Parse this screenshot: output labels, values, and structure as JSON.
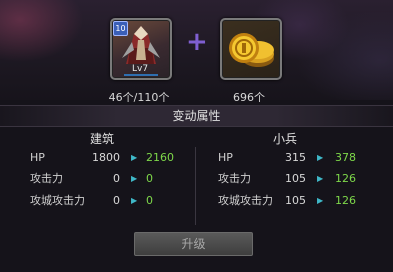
{
  "materials": {
    "unit": {
      "level_badge": "10",
      "level_text": "Lv7",
      "count": "46个/110个",
      "icon": "soldier-portrait-icon"
    },
    "coin": {
      "count": "696个",
      "icon": "gold-coins-icon"
    },
    "plus_symbol": "+"
  },
  "section_title": "变动属性",
  "building": {
    "title": "建筑",
    "rows": [
      {
        "label": "HP",
        "old": "1800",
        "new": "2160"
      },
      {
        "label": "攻击力",
        "old": "0",
        "new": "0"
      },
      {
        "label": "攻城攻击力",
        "old": "0",
        "new": "0"
      }
    ]
  },
  "soldier": {
    "title": "小兵",
    "rows": [
      {
        "label": "HP",
        "old": "315",
        "new": "378"
      },
      {
        "label": "攻击力",
        "old": "105",
        "new": "126"
      },
      {
        "label": "攻城攻击力",
        "old": "105",
        "new": "126"
      }
    ]
  },
  "upgrade_label": "升级",
  "colors": {
    "increase": "#7ed84a",
    "arrow": "#3fb8c8",
    "plus": "#7f5fd0"
  }
}
